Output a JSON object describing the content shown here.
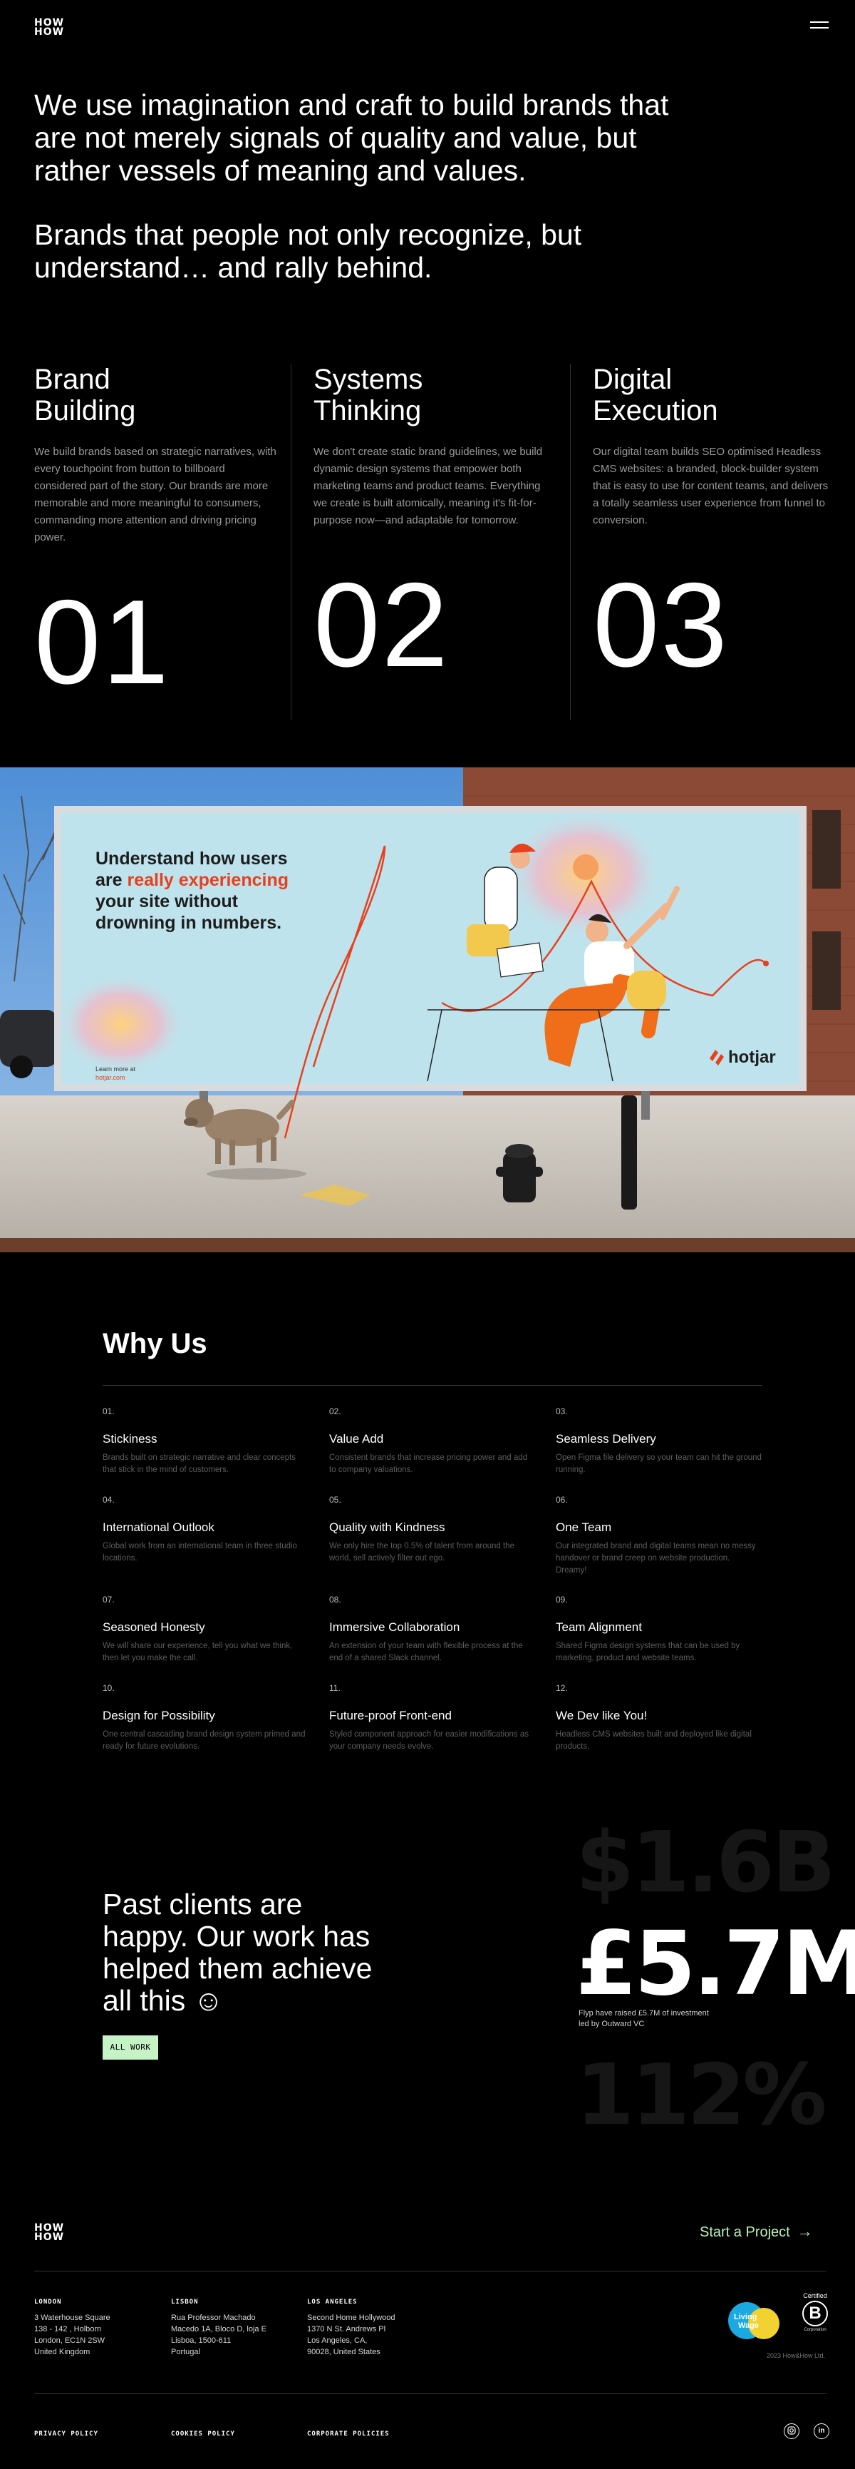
{
  "header": {
    "logo_line1": "HOW",
    "logo_line2": "HOW",
    "menu_icon": "hamburger-icon"
  },
  "intro": {
    "para1": "We use imagination and craft to build brands that are not merely signals of quality and value, but rather vessels of meaning and values.",
    "para2": "Brands that people not only recognize, but understand… and rally behind."
  },
  "pillars": [
    {
      "title_line1": "Brand",
      "title_line2": "Building",
      "desc": "We build brands based on strategic narratives, with every touchpoint from button to billboard considered part of the story. Our brands are more memorable and more meaningful to consumers, commanding more attention and driving pricing power.",
      "number": "01"
    },
    {
      "title_line1": "Systems",
      "title_line2": "Thinking",
      "desc": "We don't create static brand guidelines, we build dynamic design systems that empower both marketing teams and product teams. Everything we create is built atomically, meaning it's fit-for-purpose now—and adaptable for tomorrow.",
      "number": "02"
    },
    {
      "title_line1": "Digital",
      "title_line2": "Execution",
      "desc": "Our digital team builds SEO optimised Headless CMS websites: a branded, block-builder system that is easy to use for content teams, and delivers a totally seamless user experience from funnel to conversion.",
      "number": "03"
    }
  ],
  "billboard": {
    "line1": "Understand how users",
    "line2a": "are ",
    "line2b": "really experiencing",
    "line3": "your site without",
    "line4": "drowning in numbers.",
    "learn1": "Learn more at",
    "learn2": "hotjar.com",
    "brand": "hotjar",
    "accent": "#e8401c"
  },
  "why": {
    "title": "Why Us",
    "items": [
      {
        "num": "01.",
        "head": "Stickiness",
        "desc": "Brands built on strategic narrative and clear concepts that stick in the mind of customers."
      },
      {
        "num": "02.",
        "head": "Value Add",
        "desc": "Consistent brands that increase pricing power and add to company valuations."
      },
      {
        "num": "03.",
        "head": "Seamless Delivery",
        "desc": "Open Figma file delivery so your team can hit the ground running."
      },
      {
        "num": "04.",
        "head": "International Outlook",
        "desc": "Global work from an international team in three studio locations."
      },
      {
        "num": "05.",
        "head": "Quality with Kindness",
        "desc": "We only hire the top 0.5% of talent from around the world, sell actively filter out ego."
      },
      {
        "num": "06.",
        "head": "One Team",
        "desc": "Our integrated brand and digital teams mean no messy handover or brand creep on website production. Dreamy!"
      },
      {
        "num": "07.",
        "head": "Seasoned Honesty",
        "desc": "We will share our experience, tell you what we think, then let you make the call."
      },
      {
        "num": "08.",
        "head": "Immersive Collaboration",
        "desc": "An extension of your team with flexible process at the end of a shared Slack channel."
      },
      {
        "num": "09.",
        "head": "Team Alignment",
        "desc": "Shared Figma design systems that can be used by marketing, product and website teams."
      },
      {
        "num": "10.",
        "head": "Design for Possibility",
        "desc": "One central cascading brand design system primed and ready for future evolutions."
      },
      {
        "num": "11.",
        "head": "Future-proof Front-end",
        "desc": "Styled component approach for easier modifications as your company needs evolve."
      },
      {
        "num": "12.",
        "head": "We Dev like You!",
        "desc": "Headless CMS websites built and deployed like digital products."
      }
    ]
  },
  "clients": {
    "text": "Past clients are happy. Our work has helped them achieve all this ☺",
    "button": "ALL WORK",
    "stat_prev": "$1.6B",
    "stat_main": "£5.7M",
    "stat_caption": "Flyp have raised £5.7M of investment led by Outward VC",
    "stat_next": "112%"
  },
  "footer": {
    "logo_line1": "HOW",
    "logo_line2": "HOW",
    "cta": "Start a Project",
    "offices": [
      {
        "city": "LONDON",
        "l1": "3 Waterhouse Square",
        "l2": "138 - 142 , Holborn",
        "l3": "London, EC1N 2SW",
        "l4": "United Kingdom"
      },
      {
        "city": "LISBON",
        "l1": "Rua Professor Machado",
        "l2": "Macedo 1A, Bloco D, loja E",
        "l3": "Lisboa, 1500-611",
        "l4": "Portugal"
      },
      {
        "city": "LOS ANGELES",
        "l1": "Second Home Hollywood",
        "l2": "1370 N St. Andrews Pl",
        "l3": "Los Angeles, CA,",
        "l4": "90028, United States"
      }
    ],
    "living_wage_1": "Living",
    "living_wage_2": "Wage",
    "bcorp_certified": "Certified",
    "bcorp_letter": "B",
    "bcorp_caption": "Corporation",
    "copyright": "2023 How&How Ltd.",
    "legal": [
      "PRIVACY POLICY",
      "COOKIES POLICY",
      "CORPORATE POLICIES"
    ],
    "social_icons": [
      "instagram-icon",
      "linkedin-icon"
    ],
    "linkedin_text": "in"
  }
}
